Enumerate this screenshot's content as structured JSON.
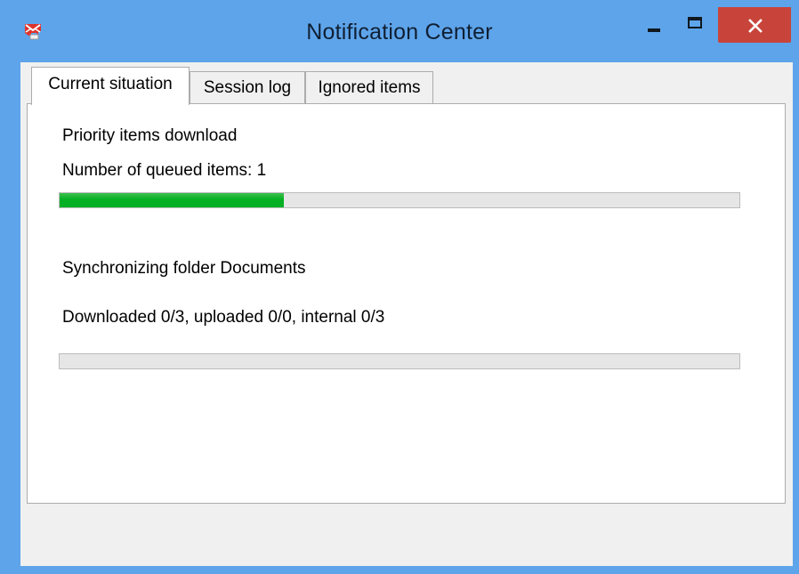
{
  "window": {
    "title": "Notification Center"
  },
  "tabs": [
    {
      "label": "Current situation",
      "active": true
    },
    {
      "label": "Session log",
      "active": false
    },
    {
      "label": "Ignored items",
      "active": false
    }
  ],
  "current": {
    "priority_title": "Priority items download",
    "queued_text": "Number of queued items: 1",
    "priority_progress": 0.33,
    "sync_title": "Synchronizing folder Documents",
    "sync_status": "Downloaded 0/3, uploaded 0/0, internal 0/3",
    "sync_progress": 0
  },
  "colors": {
    "titlebar": "#5ea4ea",
    "close_button": "#c8443a",
    "progress_fill": "#06b025"
  },
  "icons": {
    "app": "envelope-icon",
    "minimize": "minimize-icon",
    "maximize": "maximize-icon",
    "close": "close-icon"
  }
}
